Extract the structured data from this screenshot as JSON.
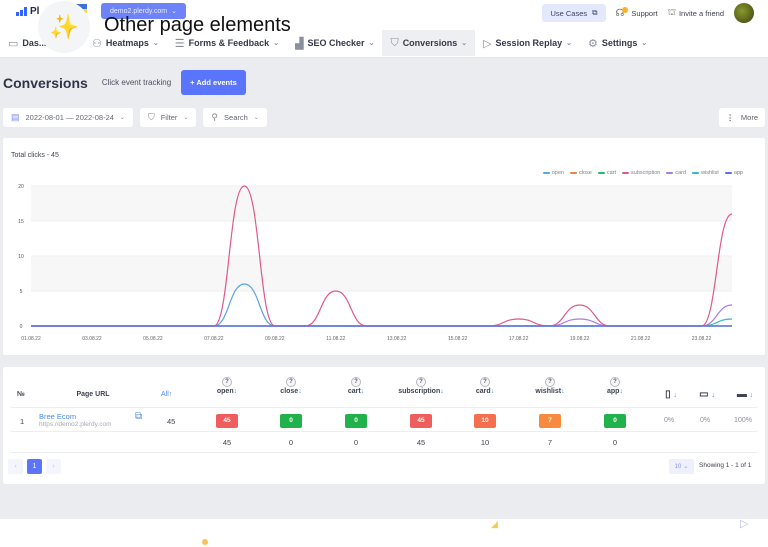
{
  "header": {
    "logo_text": "Pl",
    "domain_selector": "demo2.plerdy.com",
    "overlay_label": "Other page elements",
    "use_cases": "Use Cases",
    "support": "Support",
    "invite": "Invite a friend"
  },
  "nav": [
    {
      "label": "Dashboard",
      "icon": "monitor-icon",
      "glyph": "▭",
      "visible": "Das..."
    },
    {
      "label": "Heatmaps",
      "icon": "heatmap-icon",
      "glyph": "⚇"
    },
    {
      "label": "Forms & Feedback",
      "icon": "form-icon",
      "glyph": "☰"
    },
    {
      "label": "SEO Checker",
      "icon": "bar-chart-icon",
      "glyph": "▟"
    },
    {
      "label": "Conversions",
      "icon": "funnel-icon",
      "glyph": "⛉",
      "active": true
    },
    {
      "label": "Session Replay",
      "icon": "play-icon",
      "glyph": "▷"
    },
    {
      "label": "Settings",
      "icon": "gear-icon",
      "glyph": "⚙"
    }
  ],
  "page": {
    "title": "Conversions",
    "subtitle": "Click event tracking",
    "add_events": "+ Add events"
  },
  "filters": {
    "date_range": "2022-08-01 — 2022-08-24",
    "filter": "Filter",
    "search": "Search",
    "more": "More"
  },
  "chart_data": {
    "type": "line",
    "title": "Total clicks - 45",
    "xlabel": "",
    "ylabel": "",
    "ylim": [
      0,
      20
    ],
    "yticks": [
      0,
      5,
      10,
      15,
      20
    ],
    "x": [
      "01.08.22",
      "02.08.22",
      "03.08.22",
      "04.08.22",
      "05.08.22",
      "06.08.22",
      "07.08.22",
      "08.08.22",
      "09.08.22",
      "10.08.22",
      "11.08.22",
      "12.08.22",
      "13.08.22",
      "14.08.22",
      "15.08.22",
      "16.08.22",
      "17.08.22",
      "18.08.22",
      "19.08.22",
      "20.08.22",
      "21.08.22",
      "22.08.22",
      "23.08.22",
      "24.08.22"
    ],
    "xticks": [
      "01.08.22",
      "03.08.22",
      "05.08.22",
      "07.08.22",
      "09.08.22",
      "11.08.22",
      "13.08.22",
      "15.08.22",
      "17.08.22",
      "19.08.22",
      "21.08.22",
      "23.08.22"
    ],
    "legend_position": "top-right",
    "grid": true,
    "series": [
      {
        "name": "open",
        "color": "#5ba3e8",
        "values": [
          0,
          0,
          0,
          0,
          0,
          0,
          0,
          6,
          0,
          0,
          0,
          0,
          0,
          0,
          0,
          0,
          0,
          0,
          0,
          0,
          0,
          0,
          0,
          0
        ]
      },
      {
        "name": "close",
        "color": "#f0834a",
        "values": [
          0,
          0,
          0,
          0,
          0,
          0,
          0,
          0,
          0,
          0,
          0,
          0,
          0,
          0,
          0,
          0,
          0,
          0,
          0,
          0,
          0,
          0,
          0,
          0
        ]
      },
      {
        "name": "cart",
        "color": "#2bb673",
        "values": [
          0,
          0,
          0,
          0,
          0,
          0,
          0,
          0,
          0,
          0,
          0,
          0,
          0,
          0,
          0,
          0,
          0,
          0,
          0,
          0,
          0,
          0,
          0,
          0
        ]
      },
      {
        "name": "subscription",
        "color": "#e0598b",
        "values": [
          0,
          0,
          0,
          0,
          0,
          0,
          0,
          20,
          0,
          0,
          5,
          0,
          0,
          0,
          0,
          0,
          1,
          0,
          3,
          0,
          0,
          0,
          0,
          16
        ]
      },
      {
        "name": "card",
        "color": "#a77be8",
        "values": [
          0,
          0,
          0,
          0,
          0,
          0,
          0,
          0,
          0,
          0,
          0,
          0,
          0,
          0,
          0,
          0,
          0,
          0,
          1,
          0,
          0,
          0,
          0,
          3
        ]
      },
      {
        "name": "wishlist",
        "color": "#2ebac6",
        "values": [
          0,
          0,
          0,
          0,
          0,
          0,
          0,
          0,
          0,
          0,
          0,
          0,
          0,
          0,
          0,
          0,
          0,
          0,
          0,
          0,
          0,
          0,
          0,
          1
        ]
      },
      {
        "name": "app",
        "color": "#5b6df0",
        "values": [
          0,
          0,
          0,
          0,
          0,
          0,
          0,
          0,
          0,
          0,
          0,
          0,
          0,
          0,
          0,
          0,
          0,
          0,
          0,
          0,
          0,
          0,
          0,
          0
        ]
      }
    ]
  },
  "table": {
    "headers": {
      "no": "№",
      "page_url": "Page URL",
      "all": "All",
      "events": [
        "open",
        "close",
        "cart",
        "subscription",
        "card",
        "wishlist",
        "app"
      ],
      "help": "?",
      "devices": [
        "mobile",
        "tablet",
        "desktop"
      ]
    },
    "rows": [
      {
        "no": "1",
        "title": "Bree Ecom",
        "url": "https://demo2.plerdy.com",
        "all": "45",
        "events": [
          {
            "value": "45",
            "color": "#ef5d5d"
          },
          {
            "value": "0",
            "color": "#22b24c"
          },
          {
            "value": "0",
            "color": "#22b24c"
          },
          {
            "value": "45",
            "color": "#ef5d5d"
          },
          {
            "value": "10",
            "color": "#f56f4c"
          },
          {
            "value": "7",
            "color": "#f78a3e"
          },
          {
            "value": "0",
            "color": "#22b24c"
          }
        ],
        "devices": [
          "0%",
          "0%",
          "100%"
        ]
      }
    ],
    "totals": [
      "45",
      "0",
      "0",
      "45",
      "10",
      "7",
      "0"
    ]
  },
  "pagination": {
    "prev": "‹",
    "current": "1",
    "next": "›",
    "per_page": "10",
    "showing": "Showing 1 - 1 of 1"
  }
}
